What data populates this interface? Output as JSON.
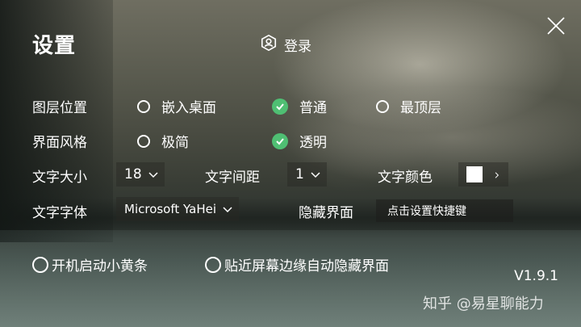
{
  "header": {
    "title": "设置",
    "login_label": "登录"
  },
  "layer_position": {
    "label": "图层位置",
    "options": [
      {
        "label": "嵌入桌面",
        "selected": false
      },
      {
        "label": "普通",
        "selected": true
      },
      {
        "label": "最顶层",
        "selected": false
      }
    ]
  },
  "ui_style": {
    "label": "界面风格",
    "options": [
      {
        "label": "极简",
        "selected": false
      },
      {
        "label": "透明",
        "selected": true
      }
    ]
  },
  "font_size": {
    "label": "文字大小",
    "value": "18"
  },
  "letter_spacing": {
    "label": "文字间距",
    "value": "1"
  },
  "text_color": {
    "label": "文字颜色",
    "value": "#ffffff"
  },
  "font_family": {
    "label": "文字字体",
    "value": "Microsoft YaHei"
  },
  "hide_ui": {
    "label": "隐藏界面",
    "hotkey_placeholder": "点击设置快捷键"
  },
  "options": {
    "autostart": {
      "label": "开机启动小黄条",
      "checked": false
    },
    "edge_hide": {
      "label": "贴近屏幕边缘自动隐藏界面",
      "checked": false
    }
  },
  "version": "V1.9.1",
  "watermark": "知乎 @易星聊能力",
  "colors": {
    "accent": "#4fbf73"
  }
}
